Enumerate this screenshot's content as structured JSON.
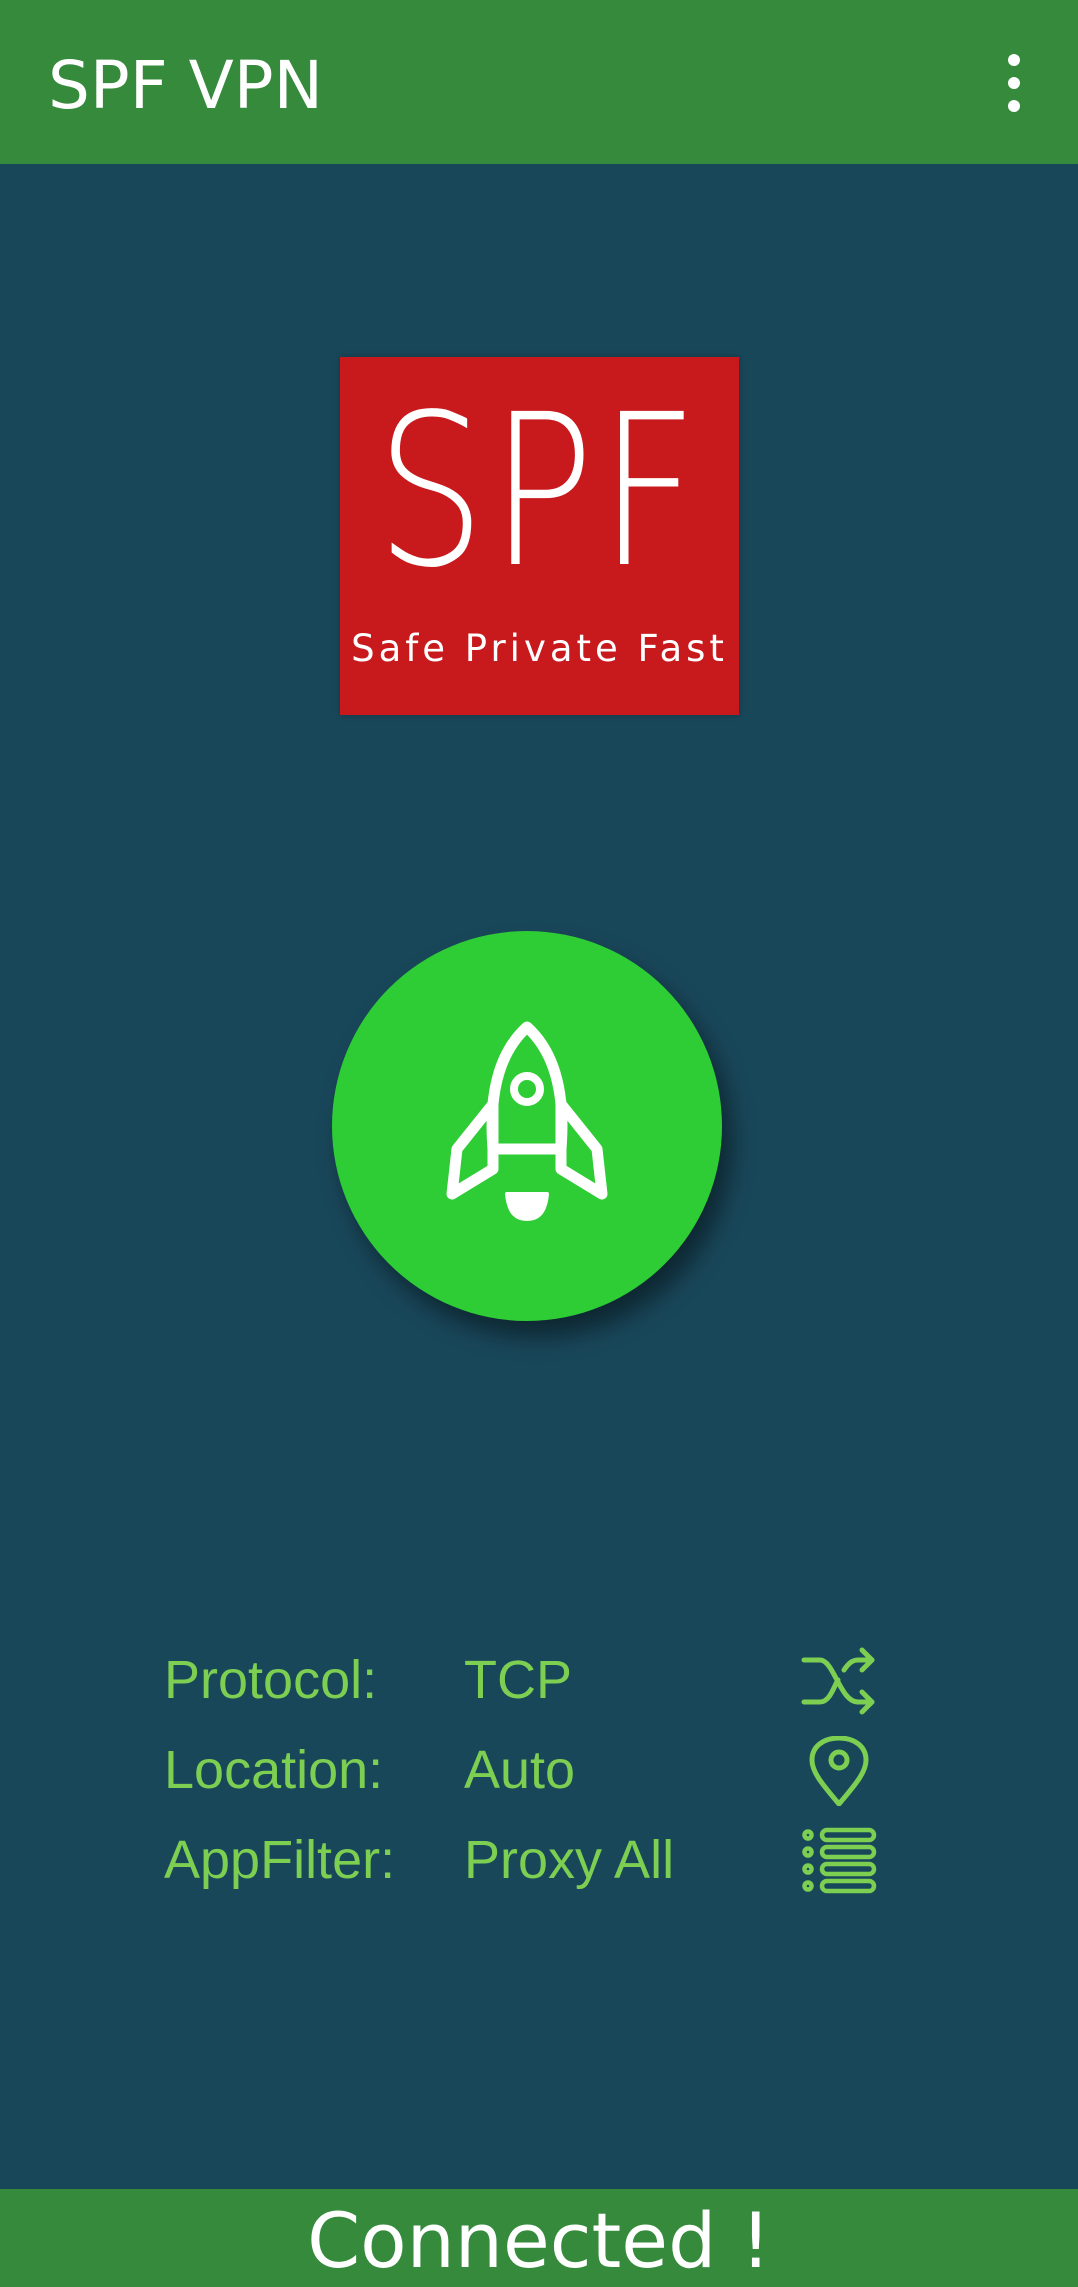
{
  "appbar": {
    "title": "SPF VPN",
    "menu_icon": "more-vert-icon"
  },
  "logo": {
    "text": "SPF",
    "tagline": "Safe Private Fast",
    "background": "#c81a1d"
  },
  "connect_button": {
    "icon": "rocket-icon",
    "color": "#2ecc35"
  },
  "info": {
    "protocol": {
      "label": "Protocol:",
      "value": "TCP",
      "icon": "shuffle-icon"
    },
    "location": {
      "label": "Location:",
      "value": "Auto",
      "icon": "location-pin-icon"
    },
    "appfilter": {
      "label": "AppFilter:",
      "value": "Proxy All",
      "icon": "list-icon"
    }
  },
  "status": {
    "text": "Connected !"
  },
  "colors": {
    "appbar": "#358a3b",
    "background": "#19475a",
    "accent_text": "#7dcf52"
  }
}
